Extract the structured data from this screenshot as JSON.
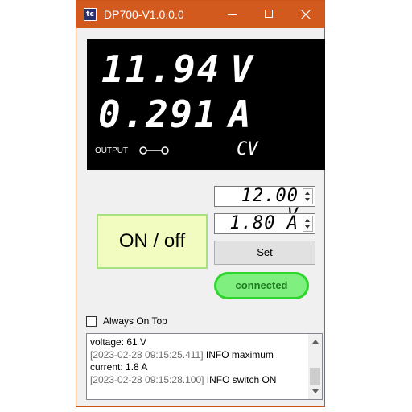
{
  "window": {
    "title": "DP700-V1.0.0.0",
    "app_icon_text": "tc",
    "accent_color": "#d25a1e"
  },
  "display": {
    "voltage": "11.94",
    "voltage_unit": "V",
    "current": "0.291",
    "current_unit": "A",
    "output_label": "OUTPUT",
    "mode": "CV"
  },
  "controls": {
    "onoff_label": "ON / off",
    "voltage_setpoint": "12.00",
    "voltage_setpoint_unit": "V",
    "current_setpoint": "1.80",
    "current_setpoint_unit": "A",
    "set_label": "Set",
    "status_label": "connected",
    "status_color": "#7ff07f"
  },
  "always_on_top": {
    "label": "Always On Top",
    "checked": false
  },
  "log": {
    "lines": [
      {
        "time": "",
        "text": "voltage: 61 V"
      },
      {
        "time": "[2023-02-28 09:15:25.411]",
        "text": " INFO maximum"
      },
      {
        "time": "",
        "text": "current: 1.8 A"
      },
      {
        "time": "[2023-02-28 09:15:28.100]",
        "text": " INFO switch ON"
      }
    ]
  }
}
